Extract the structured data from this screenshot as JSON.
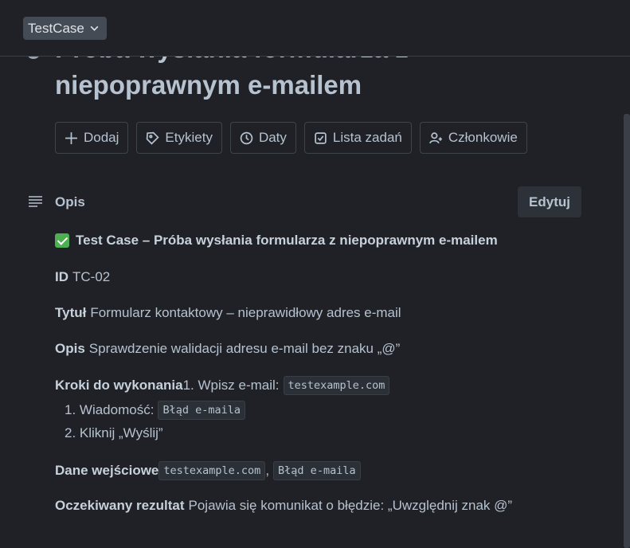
{
  "header": {
    "board_select": "TestCase"
  },
  "card": {
    "title": "Próba wysłania formularza z niepoprawnym e-mailem"
  },
  "actions": {
    "add": "Dodaj",
    "labels": "Etykiety",
    "dates": "Daty",
    "checklist": "Lista zadań",
    "members": "Członkowie"
  },
  "description": {
    "section_label": "Opis",
    "edit_button": "Edytuj",
    "heading": "Test Case – Próba wysłania formularza z niepoprawnym e-mailem",
    "id_label": "ID",
    "id_value": "TC-02",
    "title_label": "Tytuł",
    "title_value": "Formularz kontaktowy – nieprawidłowy adres e-mail",
    "desc_label": "Opis",
    "desc_value": "Sprawdzenie walidacji adresu e-mail bez znaku „@”",
    "steps_label": "Kroki do wykonania",
    "step1_prefix": "1. Wpisz e-mail:",
    "step1_code": "testexample.com",
    "step2_prefix": "1. Wiadomość:",
    "step2_code": "Błąd e-maila",
    "step3": "2. Kliknij „Wyślij”",
    "input_label": "Dane wejściowe",
    "input_code1": "testexample.com",
    "input_sep": ",",
    "input_code2": "Błąd e-maila",
    "result_label": "Oczekiwany rezultat",
    "result_value": "Pojawia się komunikat o błędzie: „Uwzględnij znak @”"
  }
}
